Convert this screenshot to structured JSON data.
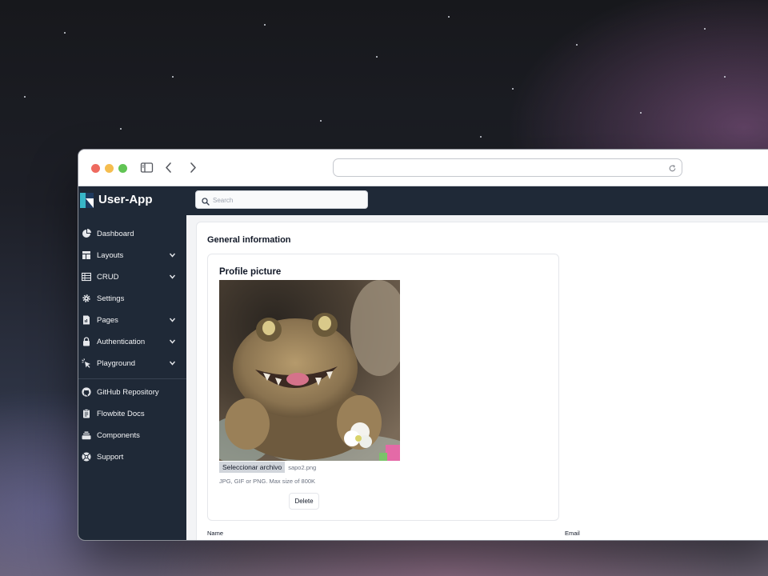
{
  "app": {
    "title": "User-App"
  },
  "search": {
    "placeholder": "Search"
  },
  "sidebar": {
    "items": [
      {
        "label": "Dashboard",
        "icon": "pie-chart-icon",
        "expandable": false
      },
      {
        "label": "Layouts",
        "icon": "layout-icon",
        "expandable": true
      },
      {
        "label": "CRUD",
        "icon": "table-icon",
        "expandable": true
      },
      {
        "label": "Settings",
        "icon": "gear-icon",
        "expandable": false
      },
      {
        "label": "Pages",
        "icon": "document-icon",
        "expandable": true
      },
      {
        "label": "Authentication",
        "icon": "lock-icon",
        "expandable": true
      },
      {
        "label": "Playground",
        "icon": "cursor-click-icon",
        "expandable": true
      }
    ],
    "secondary": [
      {
        "label": "GitHub Repository",
        "icon": "github-icon"
      },
      {
        "label": "Flowbite Docs",
        "icon": "clipboard-icon"
      },
      {
        "label": "Components",
        "icon": "stack-icon"
      },
      {
        "label": "Support",
        "icon": "lifebuoy-icon"
      }
    ]
  },
  "main": {
    "section_title": "General information",
    "profile": {
      "title": "Profile picture",
      "file_button": "Seleccionar archivo",
      "file_name": "sapo2.png",
      "hint": "JPG, GIF or PNG. Max size of 800K",
      "delete_label": "Delete"
    },
    "fields": {
      "name_label": "Name",
      "email_label": "Email"
    }
  },
  "colors": {
    "sidebar_bg": "#1f2937",
    "content_bg": "#f3f4f6",
    "logo_teal": "#38b6c8",
    "logo_navy": "#1e3a5f"
  }
}
